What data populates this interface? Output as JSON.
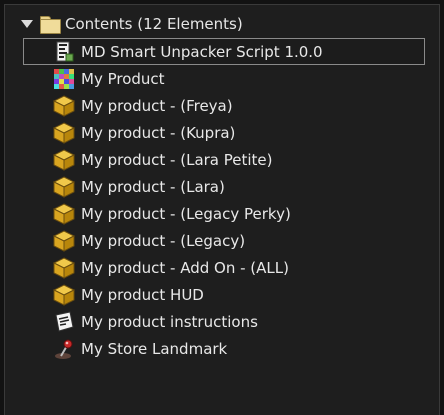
{
  "folder": {
    "label": "Contents (12 Elements)"
  },
  "items": [
    {
      "label": "MD Smart Unpacker Script 1.0.0",
      "icon": "script-icon",
      "selected": true
    },
    {
      "label": "My Product",
      "icon": "texture-icon",
      "selected": false
    },
    {
      "label": "My product - (Freya)",
      "icon": "object-box-icon",
      "selected": false
    },
    {
      "label": "My product - (Kupra)",
      "icon": "object-box-icon",
      "selected": false
    },
    {
      "label": "My product - (Lara Petite)",
      "icon": "object-box-icon",
      "selected": false
    },
    {
      "label": "My product - (Lara)",
      "icon": "object-box-icon",
      "selected": false
    },
    {
      "label": "My product - (Legacy Perky)",
      "icon": "object-box-icon",
      "selected": false
    },
    {
      "label": "My product - (Legacy)",
      "icon": "object-box-icon",
      "selected": false
    },
    {
      "label": "My product - Add On - (ALL)",
      "icon": "object-box-icon",
      "selected": false
    },
    {
      "label": "My product HUD",
      "icon": "object-box-icon",
      "selected": false
    },
    {
      "label": "My product instructions",
      "icon": "notecard-icon",
      "selected": false
    },
    {
      "label": "My Store Landmark",
      "icon": "landmark-icon",
      "selected": false
    }
  ]
}
